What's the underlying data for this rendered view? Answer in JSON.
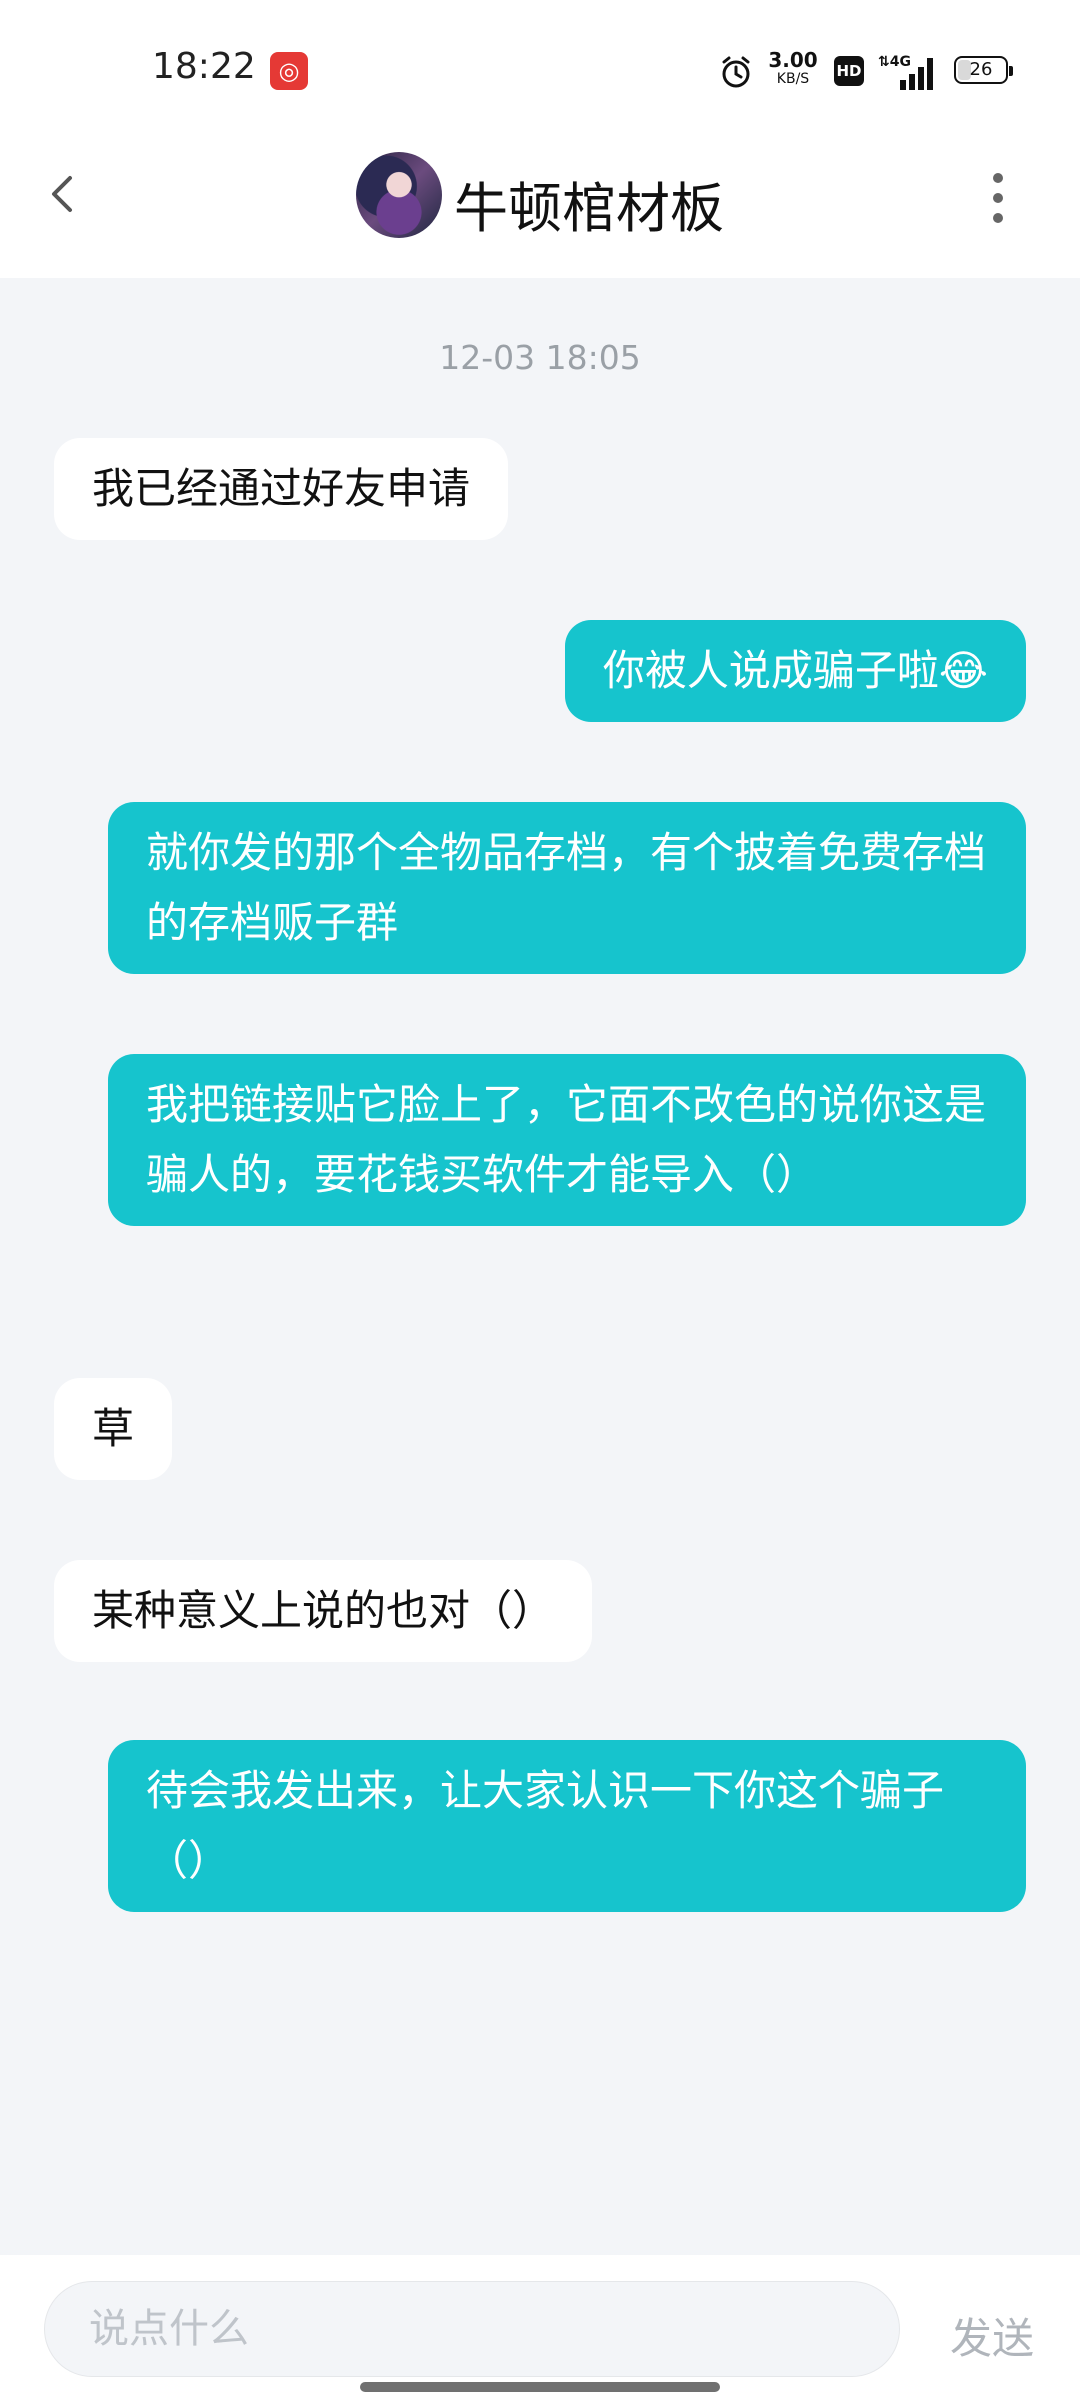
{
  "status_bar": {
    "time": "18:22",
    "net_speed_value": "3.00",
    "net_speed_unit": "KB/S",
    "hd_label": "HD",
    "battery": "26",
    "icons": [
      "netease-music-icon",
      "alarm-icon",
      "hd-icon",
      "signal-4g-icon",
      "battery-icon"
    ]
  },
  "header": {
    "title": "牛顿棺材板",
    "back_icon": "chevron-left-icon",
    "more_icon": "more-vertical-icon"
  },
  "chat": {
    "timestamp": "12-03 18:05",
    "messages": [
      {
        "side": "left",
        "text": "我已经通过好友申请"
      },
      {
        "side": "right",
        "text": "你被人说成骗子啦😂"
      },
      {
        "side": "right",
        "text": "就你发的那个全物品存档，有个披着免费存档的存档贩子群"
      },
      {
        "side": "right",
        "text": "我把链接贴它脸上了，它面不改色的说你这是骗人的，要花钱买软件才能导入（）"
      },
      {
        "side": "left",
        "text": "草"
      },
      {
        "side": "left",
        "text": "某种意义上说的也对（）"
      },
      {
        "side": "right",
        "text": "待会我发出来，让大家认识一下你这个骗子（）"
      }
    ]
  },
  "input": {
    "placeholder": "说点什么",
    "send_label": "发送"
  },
  "colors": {
    "accent": "#16c4cd",
    "background": "#f3f5f8"
  }
}
